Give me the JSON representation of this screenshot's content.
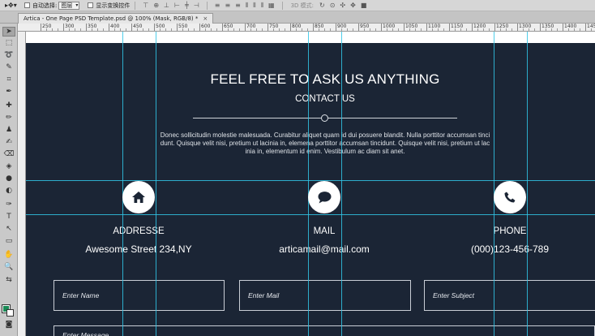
{
  "options_bar": {
    "auto_select_label": "自动选择:",
    "auto_select_value": "图层",
    "transform_label": "显示变换控件",
    "mode_3d_label": "3D 模式:"
  },
  "document": {
    "tab_title": "Artica - One Page PSD Template.psd @ 100% (Mask, RGB/8) *",
    "close_glyph": "×"
  },
  "ruler": {
    "labels": [
      "250",
      "300",
      "350",
      "400",
      "450",
      "500",
      "550",
      "600",
      "650",
      "700",
      "750",
      "800",
      "850",
      "900",
      "950",
      "1000",
      "1050",
      "1100",
      "1150",
      "1200",
      "1250",
      "1300",
      "1350",
      "1400",
      "1450"
    ]
  },
  "design": {
    "heading": "FEEL FREE TO ASK US ANYTHING",
    "subheading": "CONTACT US",
    "paragraph_lines": [
      "Donec sollicitudin molestie malesuada. Curabitur aliquet quam id dui posuere blandit. Nulla porttitor accumsan tinci",
      "dunt. Quisque velit nisi, pretium ut lacinia in, elemena porttitor accumsan tincidunt. Quisque velit nisi, pretium ut lac",
      "inia in, elementum id enim. Vestibulum ac diam sit anet."
    ],
    "contacts": [
      {
        "title": "ADDRESSE",
        "value": "Awesome Street 234,NY",
        "icon": "home-icon"
      },
      {
        "title": "MAIL",
        "value": "articamail@mail.com",
        "icon": "chat-icon"
      },
      {
        "title": "PHONE",
        "value": "(000)123-456-789",
        "icon": "phone-icon"
      }
    ],
    "form": {
      "name_placeholder": "Enter Name",
      "mail_placeholder": "Enter Mail",
      "subject_placeholder": "Enter Subject",
      "message_placeholder": "Enter Message"
    }
  },
  "colors": {
    "canvas_bg": "#1b2535",
    "guide": "#30c6e6",
    "foreground_swatch": "#1a8a56",
    "background_swatch": "#ffffff"
  }
}
